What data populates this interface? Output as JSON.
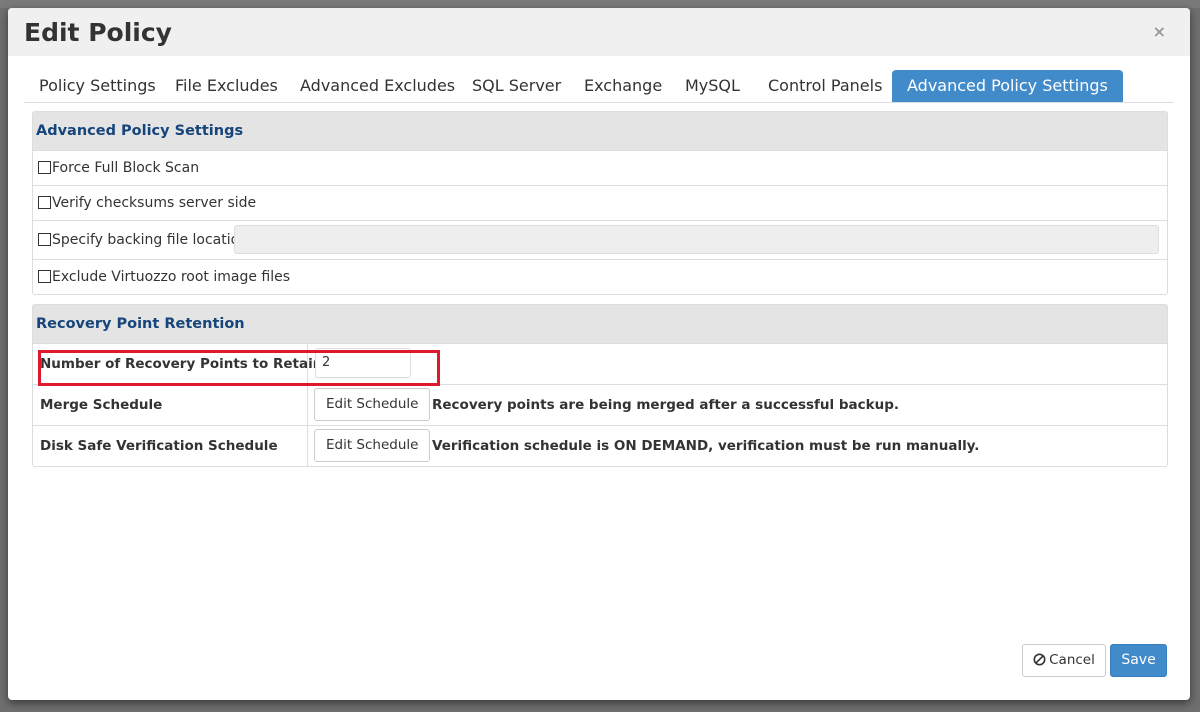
{
  "modal": {
    "title": "Edit Policy",
    "close_symbol": "×"
  },
  "tabs": [
    {
      "label": "Policy Settings",
      "active": false
    },
    {
      "label": "File Excludes",
      "active": false
    },
    {
      "label": "Advanced Excludes",
      "active": false
    },
    {
      "label": "SQL Server",
      "active": false
    },
    {
      "label": "Exchange",
      "active": false
    },
    {
      "label": "MySQL",
      "active": false
    },
    {
      "label": "Control Panels",
      "active": false
    },
    {
      "label": "Advanced Policy Settings",
      "active": true
    }
  ],
  "advanced_settings": {
    "heading": "Advanced Policy Settings",
    "options": [
      {
        "label": "Force Full Block Scan",
        "checked": false
      },
      {
        "label": "Verify checksums server side",
        "checked": false
      },
      {
        "label": "Specify backing file location",
        "checked": false,
        "input_value": ""
      },
      {
        "label": "Exclude Virtuozzo root image files",
        "checked": false
      }
    ]
  },
  "retention": {
    "heading": "Recovery Point Retention",
    "rows": [
      {
        "label": "Number of Recovery Points to Retain",
        "value": "2"
      },
      {
        "label": "Merge Schedule",
        "button": "Edit Schedule",
        "text": "Recovery points are being merged after a successful backup."
      },
      {
        "label": "Disk Safe Verification Schedule",
        "button": "Edit Schedule",
        "text": "Verification schedule is ON DEMAND, verification must be run manually."
      }
    ]
  },
  "footer": {
    "cancel_label": "Cancel",
    "save_label": "Save"
  },
  "colors": {
    "primary": "#428bca",
    "heading_text": "#15457a",
    "highlight": "#e0182f"
  },
  "icons": {
    "close": "close-icon",
    "cancel": "ban-icon"
  }
}
